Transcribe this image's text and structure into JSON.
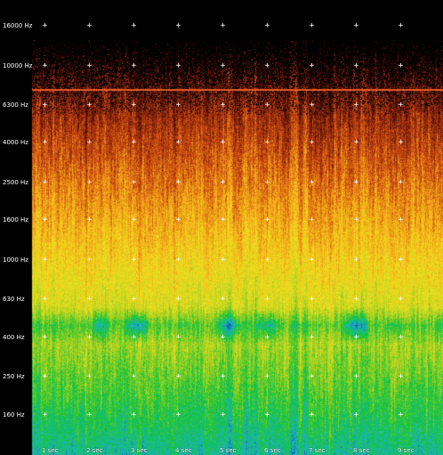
{
  "chart_data": {
    "type": "heatmap",
    "frequency_labels": [
      "16000 Hz",
      "10000 Hz",
      "6300 Hz",
      "4000 Hz",
      "2500 Hz",
      "1600 Hz",
      "1000 Hz",
      "630 Hz",
      "400 Hz",
      "250 Hz",
      "160 Hz"
    ],
    "time_labels": [
      "1 sec",
      "2 sec",
      "3 sec",
      "4 sec",
      "5 sec",
      "6 sec",
      "7 sec",
      "8 sec",
      "9 sec"
    ],
    "colormap": [
      "#0a24b0",
      "#1fb4c8",
      "#11c43a",
      "#a8d020",
      "#f0e020",
      "#f2a618",
      "#c84410",
      "#5a1208",
      "#000000"
    ],
    "background_color": "#000000",
    "highlight_line_color": "#e85a2a",
    "grid_mark_color": "#ffffff"
  }
}
